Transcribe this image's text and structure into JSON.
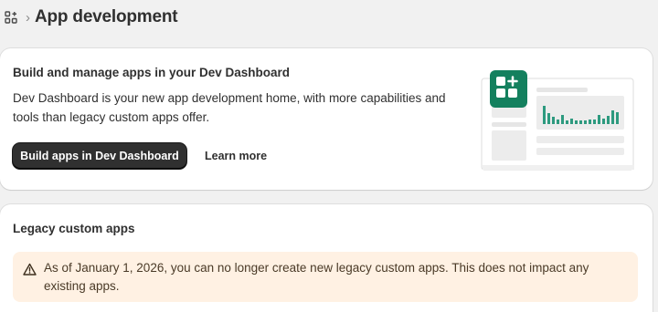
{
  "header": {
    "title": "App development",
    "icon": "apps-icon",
    "separator_icon": "chevron-right-icon"
  },
  "dev_dashboard_card": {
    "title": "Build and manage apps in your Dev Dashboard",
    "description": "Dev Dashboard is your new app development home, with more capabilities and tools than legacy custom apps offer.",
    "primary_button": "Build apps in Dev Dashboard",
    "secondary_link": "Learn more",
    "illustration": "dev-dashboard-illustration",
    "accent_color": "#14805e"
  },
  "legacy_card": {
    "title": "Legacy custom apps",
    "banner": {
      "icon": "warning-icon",
      "text": "As of January 1, 2026, you can no longer create new legacy custom apps. This does not impact any existing apps.",
      "background": "#fff1e3"
    }
  }
}
